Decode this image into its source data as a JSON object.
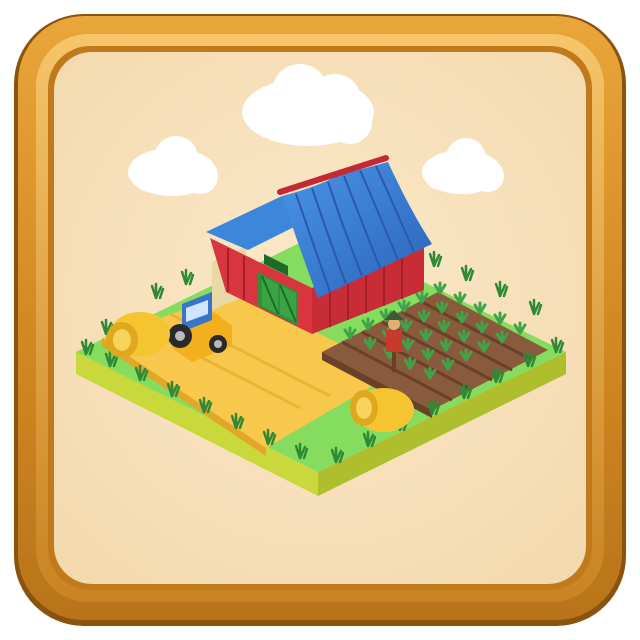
{
  "icon": {
    "subject": "farm",
    "colors": {
      "frame_gold": "#d9952c",
      "frame_gold_dark": "#a86a14",
      "frame_gold_light": "#f2b950",
      "panel_bg": "#f8e2bd",
      "grass": "#7ed957",
      "grass_side": "#c5d93a",
      "dirt": "#8a5a3c",
      "wheat_field": "#f6c64a",
      "barn_red": "#d6333d",
      "barn_roof_blue": "#3a7dd6",
      "barn_door_green": "#2f8f3a",
      "tractor_blue": "#3a74c9",
      "tractor_yellow": "#f2b01e",
      "hay_bale": "#f4c531",
      "cloud": "#ffffff",
      "crop_green": "#3fa34a"
    }
  }
}
